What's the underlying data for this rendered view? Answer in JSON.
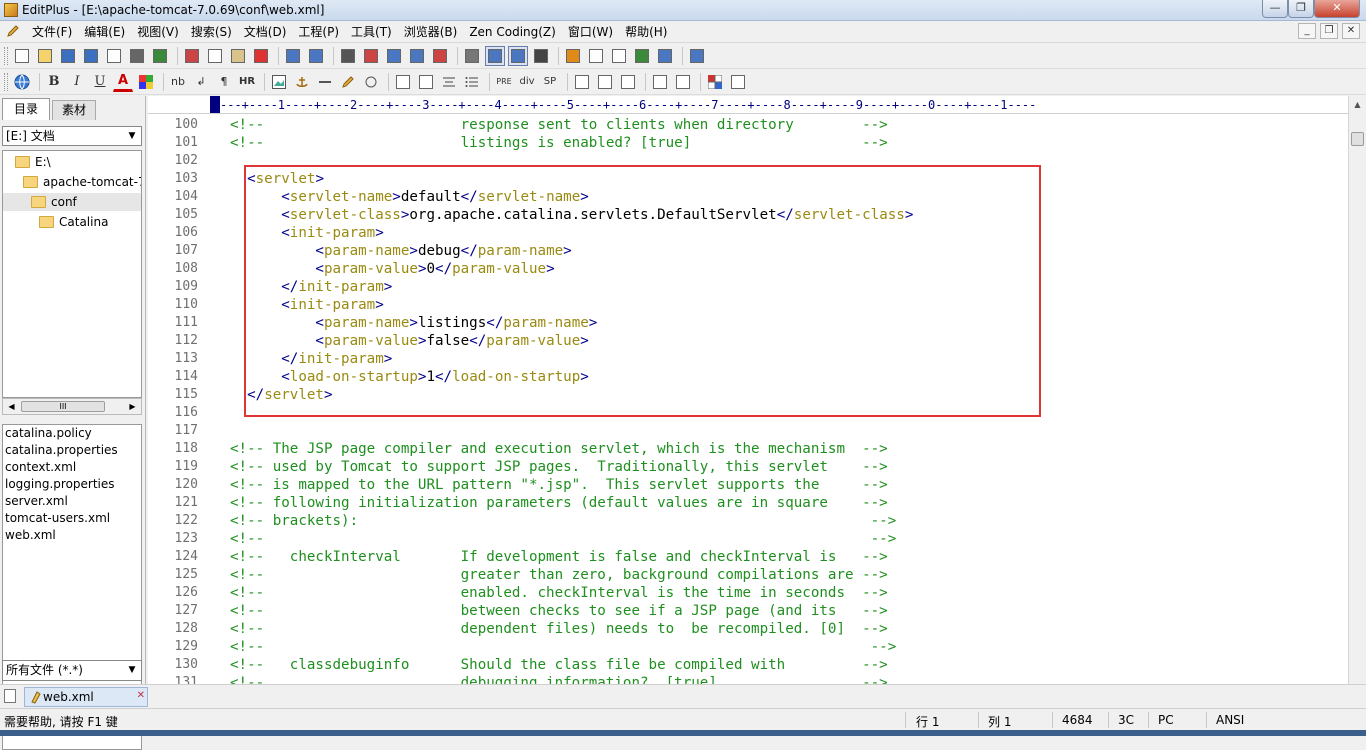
{
  "window": {
    "title": "EditPlus - [E:\\apache-tomcat-7.0.69\\conf\\web.xml]",
    "minimize": "—",
    "maximize": "❐",
    "close": "✕"
  },
  "menu": [
    "文件(F)",
    "编辑(E)",
    "视图(V)",
    "搜索(S)",
    "文档(D)",
    "工程(P)",
    "工具(T)",
    "浏览器(B)",
    "Zen Coding(Z)",
    "窗口(W)",
    "帮助(H)"
  ],
  "mdi_controls": [
    "_",
    "❐",
    "✕"
  ],
  "toolbar1": [
    "new-file",
    "open-file",
    "save",
    "save-all",
    "print-preview",
    "print",
    "spellcheck",
    "cut",
    "copy",
    "paste",
    "delete",
    "undo",
    "redo",
    "find",
    "replace",
    "find-in-files",
    "go-to-line",
    "font",
    "heading",
    "word-wrap",
    "line-numbers",
    "column-select",
    "check",
    "file-list",
    "directory",
    "browser",
    "browse",
    "help"
  ],
  "toolbar2": {
    "labels": {
      "bold": "B",
      "italic": "I",
      "underline": "U",
      "font_color": "A",
      "nbsp": "nb",
      "br": "↲",
      "paragraph": "¶",
      "hr": "HR",
      "pre": "PRE",
      "div": "div",
      "span": "SP"
    }
  },
  "left_panel": {
    "tabs": [
      "目录",
      "素材"
    ],
    "drive": "[E:] 文档",
    "tree": [
      {
        "label": "E:\\",
        "indent": 0
      },
      {
        "label": "apache-tomcat-7",
        "indent": 1
      },
      {
        "label": "conf",
        "indent": 2,
        "selected": true
      },
      {
        "label": "Catalina",
        "indent": 3
      }
    ],
    "scroll_thumb": "III",
    "files": [
      "catalina.policy",
      "catalina.properties",
      "context.xml",
      "logging.properties",
      "server.xml",
      "tomcat-users.xml",
      "web.xml"
    ],
    "filter": "所有文件 (*.*)"
  },
  "editor": {
    "ruler": "---+----1----+----2----+----3----+----4----+----5----+----6----+----7----+----8----+----9----+----0----+----1----",
    "lines": [
      {
        "n": "100",
        "segs": [
          [
            "cmt",
            "<!--                       response sent to clients when directory        -->"
          ]
        ]
      },
      {
        "n": "101",
        "segs": [
          [
            "cmt",
            "<!--                       listings is enabled? [true]                    -->"
          ]
        ]
      },
      {
        "n": "102",
        "segs": []
      },
      {
        "n": "103",
        "segs": [
          [
            "tx",
            "  "
          ],
          [
            "tag",
            "<"
          ],
          [
            "tname",
            "servlet"
          ],
          [
            "tag",
            ">"
          ]
        ]
      },
      {
        "n": "104",
        "segs": [
          [
            "tx",
            "      "
          ],
          [
            "tag",
            "<"
          ],
          [
            "tname",
            "servlet-name"
          ],
          [
            "tag",
            ">"
          ],
          [
            "tx",
            "default"
          ],
          [
            "tag",
            "</"
          ],
          [
            "tname",
            "servlet-name"
          ],
          [
            "tag",
            ">"
          ]
        ]
      },
      {
        "n": "105",
        "segs": [
          [
            "tx",
            "      "
          ],
          [
            "tag",
            "<"
          ],
          [
            "tname",
            "servlet-class"
          ],
          [
            "tag",
            ">"
          ],
          [
            "tx",
            "org.apache.catalina.servlets.DefaultServlet"
          ],
          [
            "tag",
            "</"
          ],
          [
            "tname",
            "servlet-class"
          ],
          [
            "tag",
            ">"
          ]
        ]
      },
      {
        "n": "106",
        "segs": [
          [
            "tx",
            "      "
          ],
          [
            "tag",
            "<"
          ],
          [
            "tname",
            "init-param"
          ],
          [
            "tag",
            ">"
          ]
        ]
      },
      {
        "n": "107",
        "segs": [
          [
            "tx",
            "          "
          ],
          [
            "tag",
            "<"
          ],
          [
            "tname",
            "param-name"
          ],
          [
            "tag",
            ">"
          ],
          [
            "tx",
            "debug"
          ],
          [
            "tag",
            "</"
          ],
          [
            "tname",
            "param-name"
          ],
          [
            "tag",
            ">"
          ]
        ]
      },
      {
        "n": "108",
        "segs": [
          [
            "tx",
            "          "
          ],
          [
            "tag",
            "<"
          ],
          [
            "tname",
            "param-value"
          ],
          [
            "tag",
            ">"
          ],
          [
            "tx",
            "0"
          ],
          [
            "tag",
            "</"
          ],
          [
            "tname",
            "param-value"
          ],
          [
            "tag",
            ">"
          ]
        ]
      },
      {
        "n": "109",
        "segs": [
          [
            "tx",
            "      "
          ],
          [
            "tag",
            "</"
          ],
          [
            "tname",
            "init-param"
          ],
          [
            "tag",
            ">"
          ]
        ]
      },
      {
        "n": "110",
        "segs": [
          [
            "tx",
            "      "
          ],
          [
            "tag",
            "<"
          ],
          [
            "tname",
            "init-param"
          ],
          [
            "tag",
            ">"
          ]
        ]
      },
      {
        "n": "111",
        "segs": [
          [
            "tx",
            "          "
          ],
          [
            "tag",
            "<"
          ],
          [
            "tname",
            "param-name"
          ],
          [
            "tag",
            ">"
          ],
          [
            "tx",
            "listings"
          ],
          [
            "tag",
            "</"
          ],
          [
            "tname",
            "param-name"
          ],
          [
            "tag",
            ">"
          ]
        ]
      },
      {
        "n": "112",
        "segs": [
          [
            "tx",
            "          "
          ],
          [
            "tag",
            "<"
          ],
          [
            "tname",
            "param-value"
          ],
          [
            "tag",
            ">"
          ],
          [
            "tx",
            "false"
          ],
          [
            "tag",
            "</"
          ],
          [
            "tname",
            "param-value"
          ],
          [
            "tag",
            ">"
          ]
        ]
      },
      {
        "n": "113",
        "segs": [
          [
            "tx",
            "      "
          ],
          [
            "tag",
            "</"
          ],
          [
            "tname",
            "init-param"
          ],
          [
            "tag",
            ">"
          ]
        ]
      },
      {
        "n": "114",
        "segs": [
          [
            "tx",
            "      "
          ],
          [
            "tag",
            "<"
          ],
          [
            "tname",
            "load-on-startup"
          ],
          [
            "tag",
            ">"
          ],
          [
            "tx",
            "1"
          ],
          [
            "tag",
            "</"
          ],
          [
            "tname",
            "load-on-startup"
          ],
          [
            "tag",
            ">"
          ]
        ]
      },
      {
        "n": "115",
        "segs": [
          [
            "tx",
            "  "
          ],
          [
            "tag",
            "</"
          ],
          [
            "tname",
            "servlet"
          ],
          [
            "tag",
            ">"
          ]
        ]
      },
      {
        "n": "116",
        "segs": []
      },
      {
        "n": "117",
        "segs": []
      },
      {
        "n": "118",
        "segs": [
          [
            "cmt",
            "<!-- The JSP page compiler and execution servlet, which is the mechanism  -->"
          ]
        ]
      },
      {
        "n": "119",
        "segs": [
          [
            "cmt",
            "<!-- used by Tomcat to support JSP pages.  Traditionally, this servlet    -->"
          ]
        ]
      },
      {
        "n": "120",
        "segs": [
          [
            "cmt",
            "<!-- is mapped to the URL pattern \"*.jsp\".  This servlet supports the     -->"
          ]
        ]
      },
      {
        "n": "121",
        "segs": [
          [
            "cmt",
            "<!-- following initialization parameters (default values are in square    -->"
          ]
        ]
      },
      {
        "n": "122",
        "segs": [
          [
            "cmt",
            "<!-- brackets):                                                            -->"
          ]
        ]
      },
      {
        "n": "123",
        "segs": [
          [
            "cmt",
            "<!--                                                                       -->"
          ]
        ]
      },
      {
        "n": "124",
        "segs": [
          [
            "cmt",
            "<!--   checkInterval       If development is false and checkInterval is   -->"
          ]
        ]
      },
      {
        "n": "125",
        "segs": [
          [
            "cmt",
            "<!--                       greater than zero, background compilations are -->"
          ]
        ]
      },
      {
        "n": "126",
        "segs": [
          [
            "cmt",
            "<!--                       enabled. checkInterval is the time in seconds  -->"
          ]
        ]
      },
      {
        "n": "127",
        "segs": [
          [
            "cmt",
            "<!--                       between checks to see if a JSP page (and its   -->"
          ]
        ]
      },
      {
        "n": "128",
        "segs": [
          [
            "cmt",
            "<!--                       dependent files) needs to  be recompiled. [0]  -->"
          ]
        ]
      },
      {
        "n": "129",
        "segs": [
          [
            "cmt",
            "<!--                                                                       -->"
          ]
        ]
      },
      {
        "n": "130",
        "segs": [
          [
            "cmt",
            "<!--   classdebuginfo      Should the class file be compiled with         -->"
          ]
        ]
      },
      {
        "n": "131",
        "segs": [
          [
            "cmt",
            "<!--                       debugging information?  [true]                 -->"
          ]
        ]
      }
    ]
  },
  "doc_tab": {
    "label": "web.xml",
    "close": "✕"
  },
  "status": {
    "help": "需要帮助, 请按 F1 键",
    "line": "行 1",
    "col": "列 1",
    "size": "4684",
    "encoding_c": "3C",
    "eol": "PC",
    "mode": "ANSI"
  },
  "colors": {
    "comment": "#1f8f1f",
    "tag_bracket": "#00008b",
    "tag_name": "#9a8a12",
    "highlight_border": "#e03535"
  }
}
